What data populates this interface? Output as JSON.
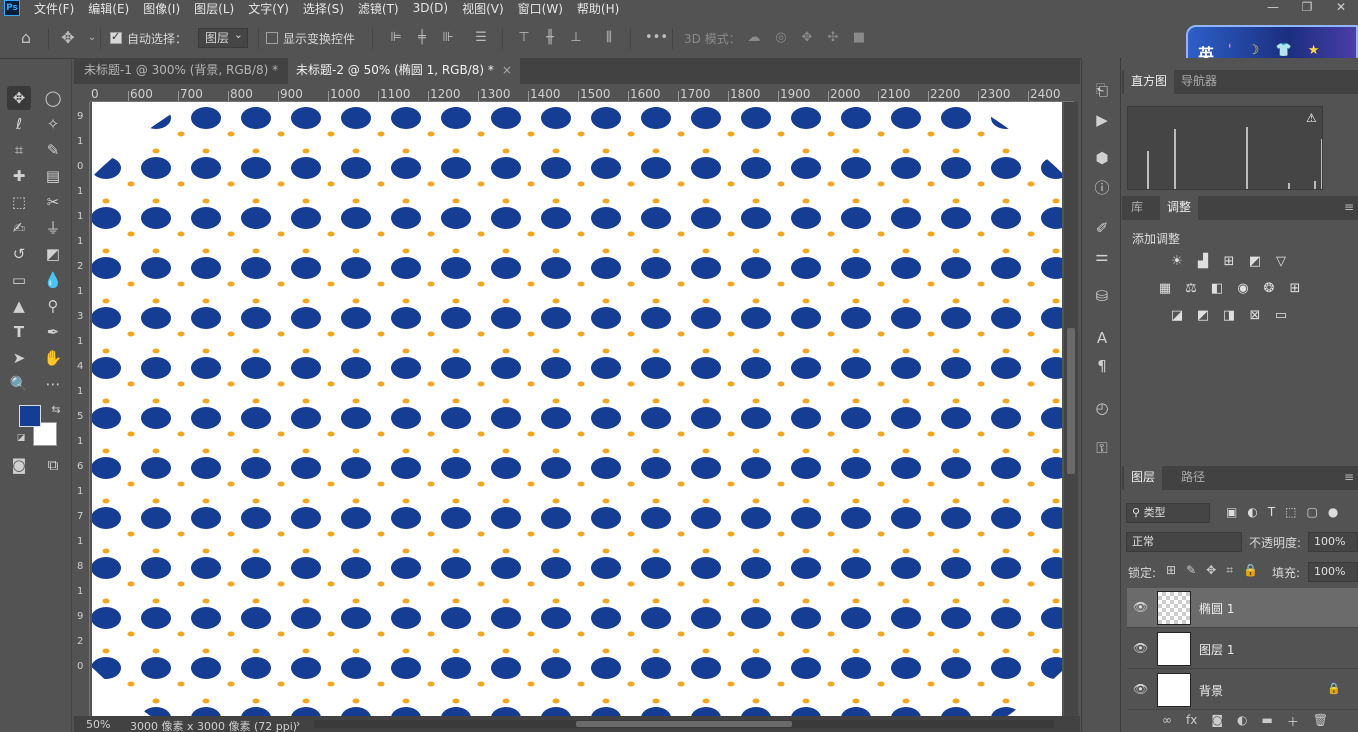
{
  "app": {
    "logo": "Ps",
    "menu": [
      "文件(F)",
      "编辑(E)",
      "图像(I)",
      "图层(L)",
      "文字(Y)",
      "选择(S)",
      "滤镜(T)",
      "3D(D)",
      "视图(V)",
      "窗口(W)",
      "帮助(H)"
    ],
    "window_controls": [
      "—",
      "❐",
      "✕"
    ]
  },
  "options_bar": {
    "auto_select_label": "自动选择：",
    "auto_select_checked": true,
    "auto_select_target": "图层",
    "show_transform_label": "显示变换控件",
    "show_transform_checked": false,
    "more_label": "•••",
    "mode_3d_label": "3D 模式："
  },
  "ime": {
    "label": "英",
    "deco": "ˈ ☽ 👕 ★"
  },
  "tabs": [
    {
      "label": "未标题-1 @ 300% (背景, RGB/8) *",
      "active": false
    },
    {
      "label": "未标题-2 @ 50% (椭圆 1, RGB/8) *",
      "active": true
    }
  ],
  "tab_close": "×",
  "ruler_top": [
    "600",
    "700",
    "800",
    "900",
    "1000",
    "1100",
    "1200",
    "1300",
    "1400",
    "1500",
    "1600",
    "1700",
    "1800",
    "1900",
    "2000",
    "2100",
    "2200",
    "2300",
    "2400"
  ],
  "ruler_left": [
    "9",
    "1",
    "0",
    "1",
    "1",
    "1",
    "2",
    "1",
    "3",
    "1",
    "4",
    "1",
    "5",
    "1",
    "6",
    "1",
    "7",
    "1",
    "8",
    "1",
    "9",
    "2",
    "0"
  ],
  "ruler_top_start": "0",
  "status": {
    "zoom": "50%",
    "doc_info": "3000 像素 x 3000 像素 (72 ppi)",
    "arrow": "›"
  },
  "panels": {
    "top_tabs": [
      "直方图",
      "导航器"
    ],
    "mid_tabs": [
      "库",
      "调整"
    ],
    "add_adjustment": "添加调整",
    "layer_tabs": [
      "图层",
      "路径"
    ],
    "filter_kind": "类型",
    "blend_mode": "正常",
    "opacity_label": "不透明度:",
    "opacity_value": "100%",
    "lock_label": "锁定:",
    "fill_label": "填充:",
    "fill_value": "100%",
    "layers": [
      {
        "name": "椭圆 1",
        "selected": true,
        "thumb": "checker",
        "locked": false
      },
      {
        "name": "图层 1",
        "selected": false,
        "thumb": "white",
        "locked": false
      },
      {
        "name": "背景",
        "selected": false,
        "thumb": "white",
        "locked": true
      }
    ],
    "layer_footer": [
      "∞",
      "fx",
      "◙",
      "◐",
      "▬",
      "＋",
      "🗑"
    ]
  },
  "colors": {
    "foreground": "#163d94",
    "background": "#ffffff",
    "dot_blue": "#163d94",
    "dot_orange": "#f2a51f"
  }
}
